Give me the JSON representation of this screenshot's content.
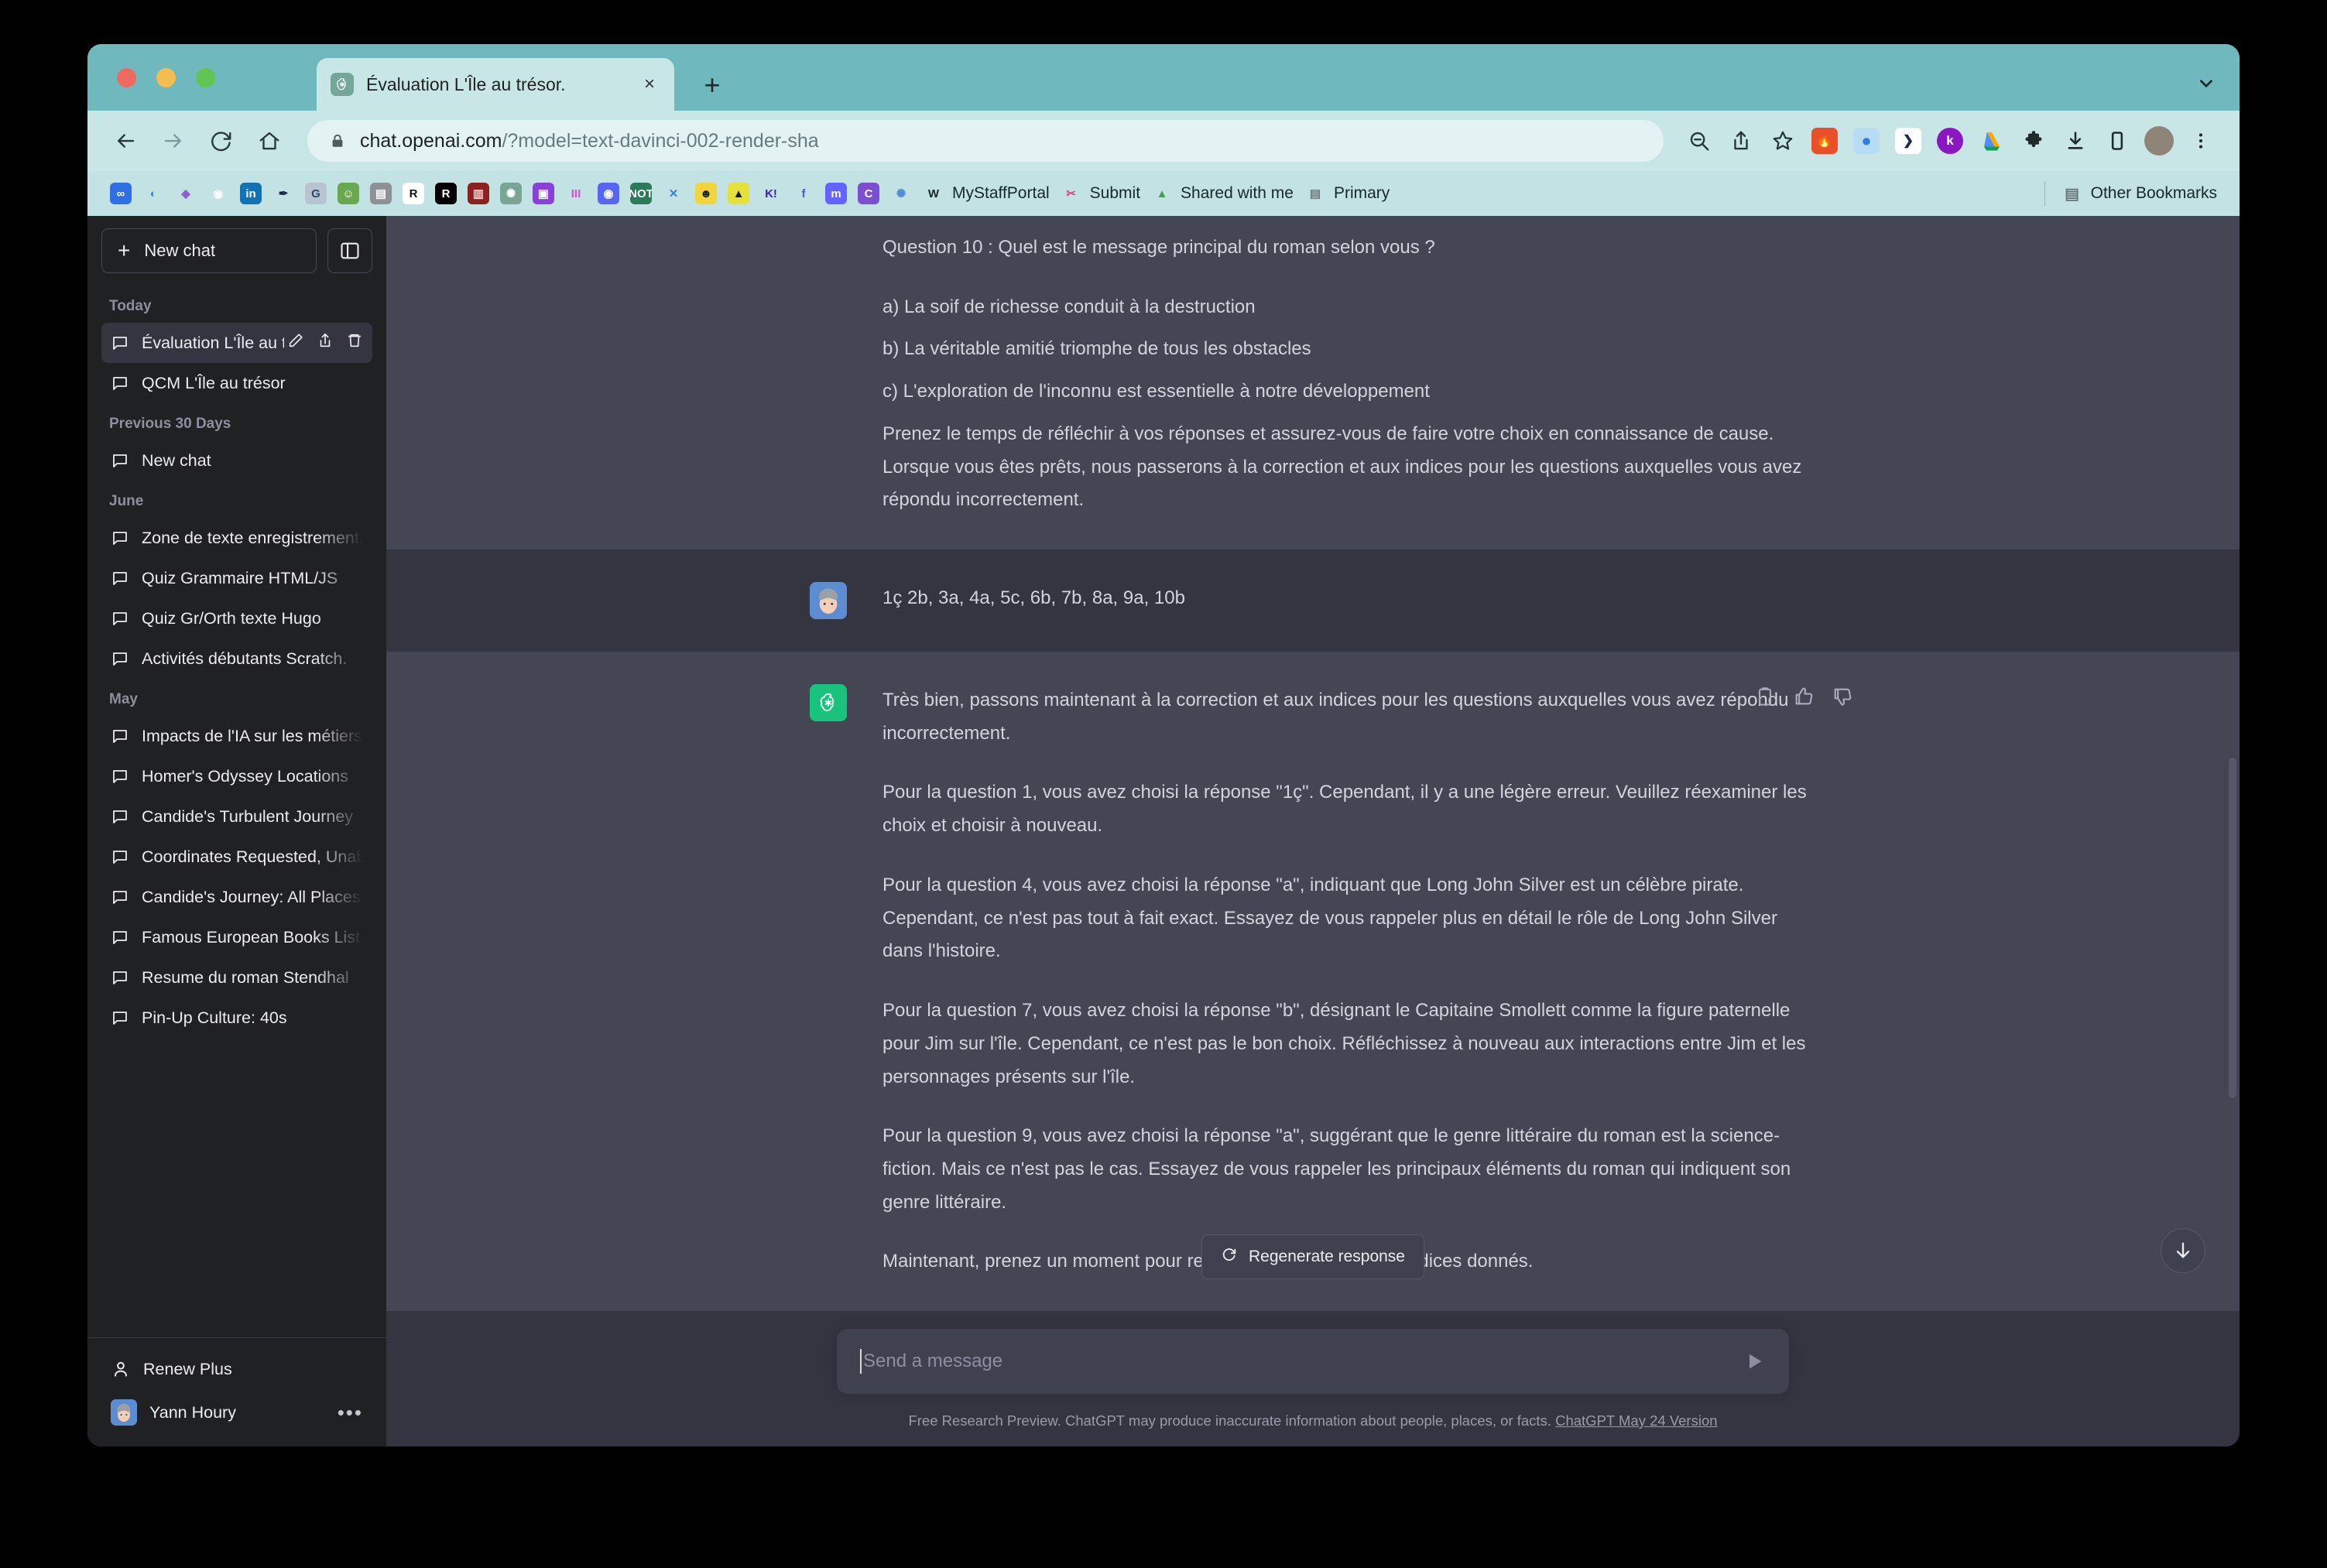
{
  "browser": {
    "tab": {
      "title": "Évaluation L'Île au trésor.",
      "favicon": "openai-icon",
      "close": "×"
    },
    "new_tab_label": "+",
    "nav": {
      "back": "←",
      "forward": "→",
      "reload": "⟳",
      "home": "⌂"
    },
    "omnibox": {
      "lock": "lock-icon",
      "url_primary": "chat.openai.com",
      "url_rest": "/?model=text-davinci-002-render-sha"
    },
    "toolbar_icons": [
      "zoom-out-icon",
      "share-icon",
      "bookmark-star-icon"
    ],
    "extensions": [
      {
        "name": "fire-extension",
        "glyph": "🔥",
        "bg": "#e8502a"
      },
      {
        "name": "blue-circle-extension",
        "glyph": "●",
        "bg": "#cfe4f7",
        "fg": "#2f7fe0"
      },
      {
        "name": "pocket-extension",
        "glyph": "❯",
        "bg": "#ffffff",
        "fg": "#1b2b4b"
      },
      {
        "name": "kami-extension",
        "glyph": "k",
        "bg": "#8b17c4"
      },
      {
        "name": "google-drive-extension",
        "glyph": "▲",
        "bg": "transparent",
        "fg": "#f9ab00"
      },
      {
        "name": "puzzle-extensions-icon",
        "glyph": "✦",
        "bg": "transparent",
        "fg": "#1f2a2c"
      },
      {
        "name": "downloads-icon",
        "glyph": "⤓",
        "bg": "transparent",
        "fg": "#1f2a2c"
      },
      {
        "name": "sidepanel-icon",
        "glyph": "▯",
        "bg": "transparent",
        "fg": "#1f2a2c"
      },
      {
        "name": "profile-avatar",
        "glyph": "",
        "bg": "#8e8478"
      },
      {
        "name": "chrome-menu-icon",
        "glyph": "⋮",
        "bg": "transparent",
        "fg": "#1f2a2c"
      }
    ],
    "bookmarks": [
      {
        "label": "",
        "icon": "infinity-icon",
        "glyph": "∞",
        "bg": "#2f6fe4",
        "fg": "#ffffff"
      },
      {
        "label": "",
        "icon": "cloud-icon",
        "glyph": "◐",
        "bg": "transparent",
        "fg": "#3f8fd4"
      },
      {
        "label": "",
        "icon": "purple-gem-icon",
        "glyph": "◆",
        "bg": "transparent",
        "fg": "#8f5fd0"
      },
      {
        "label": "",
        "icon": "github-icon",
        "glyph": "◉",
        "bg": "transparent",
        "fg": "#ffffff"
      },
      {
        "label": "",
        "icon": "linkedin-icon",
        "glyph": "in",
        "bg": "#1272b4",
        "fg": "#ffffff"
      },
      {
        "label": "",
        "icon": "dark-drop-icon",
        "glyph": "✒",
        "bg": "transparent",
        "fg": "#17243e"
      },
      {
        "label": "",
        "icon": "google-translate-icon",
        "glyph": "G",
        "bg": "#b7c4cf",
        "fg": "#2d4a6b"
      },
      {
        "label": "",
        "icon": "green-robot-icon",
        "glyph": "☺",
        "bg": "#6aa84f",
        "fg": "#ffffff"
      },
      {
        "label": "",
        "icon": "grey-building-icon",
        "glyph": "▤",
        "bg": "#8e9196",
        "fg": "#ffffff"
      },
      {
        "label": "",
        "icon": "r-outline-icon",
        "glyph": "R",
        "bg": "#ffffff",
        "fg": "#111111"
      },
      {
        "label": "",
        "icon": "r-black-icon",
        "glyph": "R",
        "bg": "#000000",
        "fg": "#ffffff"
      },
      {
        "label": "",
        "icon": "red-stripes-icon",
        "glyph": "▥",
        "bg": "#8e2020",
        "fg": "#ffd0d0"
      },
      {
        "label": "",
        "icon": "openai-icon",
        "glyph": "✺",
        "bg": "#79a496",
        "fg": "#ffffff"
      },
      {
        "label": "",
        "icon": "purple-chat-icon",
        "glyph": "▣",
        "bg": "#8a3fd6",
        "fg": "#ffffff"
      },
      {
        "label": "",
        "icon": "pink-books-icon",
        "glyph": "III",
        "bg": "transparent",
        "fg": "#d14fd0"
      },
      {
        "label": "",
        "icon": "discord-icon",
        "glyph": "◉",
        "bg": "#5865f2",
        "fg": "#ffffff"
      },
      {
        "label": "",
        "icon": "notion-icon",
        "glyph": "NOT",
        "bg": "#2b7a5a",
        "fg": "#ffffff"
      },
      {
        "label": "",
        "icon": "x-cross-icon",
        "glyph": "✕",
        "bg": "transparent",
        "fg": "#3a7fd0"
      },
      {
        "label": "",
        "icon": "yellow-face-icon",
        "glyph": "☻",
        "bg": "#f2d43c",
        "fg": "#1a1a1a"
      },
      {
        "label": "",
        "icon": "yellow-person-icon",
        "glyph": "▲",
        "bg": "#e6e03a",
        "fg": "#1a1a1a"
      },
      {
        "label": "",
        "icon": "kahoot-icon",
        "glyph": "K!",
        "bg": "transparent",
        "fg": "#3a1fb8"
      },
      {
        "label": "",
        "icon": "f-icon",
        "glyph": "f",
        "bg": "transparent",
        "fg": "#3a5fe0"
      },
      {
        "label": "",
        "icon": "mastodon-icon",
        "glyph": "m",
        "bg": "#6364ff",
        "fg": "#ffffff"
      },
      {
        "label": "",
        "icon": "c-circle-icon",
        "glyph": "C",
        "bg": "#7b4fd0",
        "fg": "#ffffff"
      },
      {
        "label": "",
        "icon": "blue-bug-icon",
        "glyph": "✺",
        "bg": "transparent",
        "fg": "#4f8fd0"
      },
      {
        "label": "MyStaffPortal",
        "icon": "w-monogram-icon",
        "glyph": "W",
        "bg": "transparent",
        "fg": "#1a2628"
      },
      {
        "label": "Submit",
        "icon": "scissors-icon",
        "glyph": "✂",
        "bg": "transparent",
        "fg": "#d04f7f"
      },
      {
        "label": "Shared with me",
        "icon": "google-drive-icon",
        "glyph": "▲",
        "bg": "transparent",
        "fg": "#3f9f4f"
      },
      {
        "label": "Primary",
        "icon": "folder-icon",
        "glyph": "▤",
        "bg": "transparent",
        "fg": "#6a7a7c"
      }
    ],
    "other_bookmarks": {
      "label": "Other Bookmarks",
      "icon": "folder-icon",
      "glyph": "▤"
    },
    "tabstrip_chevron": "chevron-down-icon"
  },
  "sidebar": {
    "new_chat": "New chat",
    "collapse_icon": "sidebar-collapse-icon",
    "groups": [
      {
        "label": "Today",
        "items": [
          {
            "title": "Évaluation L'Île au tré",
            "active": true,
            "actions": [
              "edit-icon",
              "share-icon",
              "trash-icon"
            ]
          },
          {
            "title": "QCM L'Île au trésor",
            "active": false
          }
        ]
      },
      {
        "label": "Previous 30 Days",
        "items": [
          {
            "title": "New chat",
            "active": false
          }
        ]
      },
      {
        "label": "June",
        "items": [
          {
            "title": "Zone de texte enregistrement.",
            "active": false
          },
          {
            "title": "Quiz Grammaire HTML/JS",
            "active": false
          },
          {
            "title": "Quiz Gr/Orth texte Hugo",
            "active": false
          },
          {
            "title": "Activités débutants Scratch.",
            "active": false
          }
        ]
      },
      {
        "label": "May",
        "items": [
          {
            "title": "Impacts de l'IA sur les métiers",
            "active": false
          },
          {
            "title": "Homer's Odyssey Locations",
            "active": false
          },
          {
            "title": "Candide's Turbulent Journey",
            "active": false
          },
          {
            "title": "Coordinates Requested, Unable",
            "active": false
          },
          {
            "title": "Candide's Journey: All Places",
            "active": false
          },
          {
            "title": "Famous European Books List",
            "active": false
          },
          {
            "title": "Resume du roman Stendhal",
            "active": false
          },
          {
            "title": "Pin-Up Culture: 40s",
            "active": false
          }
        ]
      }
    ],
    "footer": {
      "renew_plus": "Renew Plus",
      "renew_icon": "person-icon",
      "user_name": "Yann Houry",
      "user_avatar": "user-avatar",
      "more_icon": "ellipsis-icon"
    }
  },
  "thread": {
    "messages": [
      {
        "role": "assistant",
        "partial": true,
        "avatar": "openai-logo-icon",
        "paragraphs": [
          "Question 10 : Quel est le message principal du roman selon vous ?",
          "a) La soif de richesse conduit à la destruction",
          "b) La véritable amitié triomphe de tous les obstacles",
          "c) L'exploration de l'inconnu est essentielle à notre développement",
          "Prenez le temps de réfléchir à vos réponses et assurez-vous de faire votre choix en connaissance de cause. Lorsque vous êtes prêts, nous passerons à la correction et aux indices pour les questions auxquelles vous avez répondu incorrectement."
        ]
      },
      {
        "role": "user",
        "avatar": "user-avatar",
        "paragraphs": [
          "1ç 2b, 3a, 4a, 5c, 6b, 7b, 8a, 9a, 10b"
        ]
      },
      {
        "role": "assistant",
        "avatar": "openai-logo-icon",
        "actions": [
          "copy-icon",
          "thumbs-up-icon",
          "thumbs-down-icon"
        ],
        "paragraphs": [
          "Très bien, passons maintenant à la correction et aux indices pour les questions auxquelles vous avez répondu incorrectement.",
          "Pour la question 1, vous avez choisi la réponse \"1ç\". Cependant, il y a une légère erreur. Veuillez réexaminer les choix et choisir à nouveau.",
          "Pour la question 4, vous avez choisi la réponse \"a\", indiquant que Long John Silver est un célèbre pirate. Cependant, ce n'est pas tout à fait exact. Essayez de vous rappeler plus en détail le rôle de Long John Silver dans l'histoire.",
          "Pour la question 7, vous avez choisi la réponse \"b\", désignant le Capitaine Smollett comme la figure paternelle pour Jim sur l'île. Cependant, ce n'est pas le bon choix. Réfléchissez à nouveau aux interactions entre Jim et les personnages présents sur l'île.",
          "Pour la question 9, vous avez choisi la réponse \"a\", suggérant que le genre littéraire du roman est la science-fiction. Mais ce n'est pas le cas. Essayez de vous rappeler les principaux éléments du roman qui indiquent son genre littéraire.",
          "Maintenant, prenez un moment pour revoir vos réponses et les indices donnés."
        ]
      }
    ]
  },
  "regenerate": {
    "label": "Regenerate response",
    "icon": "refresh-icon"
  },
  "scroll_down": {
    "icon": "arrow-down-icon"
  },
  "composer": {
    "placeholder": "Send a message",
    "send_icon": "send-icon"
  },
  "footnote": {
    "text": "Free Research Preview. ChatGPT may produce inaccurate information about people, places, or facts. ",
    "link": "ChatGPT May 24 Version"
  },
  "colors": {
    "window_chrome": "#6fb8bd",
    "toolbar": "#c9e6e7",
    "bookmarks_bar": "#c2e2e3",
    "sidebar": "#202123",
    "chat_bg": "#343541",
    "assistant_bg": "#444654",
    "accent_green": "#19c37d"
  }
}
